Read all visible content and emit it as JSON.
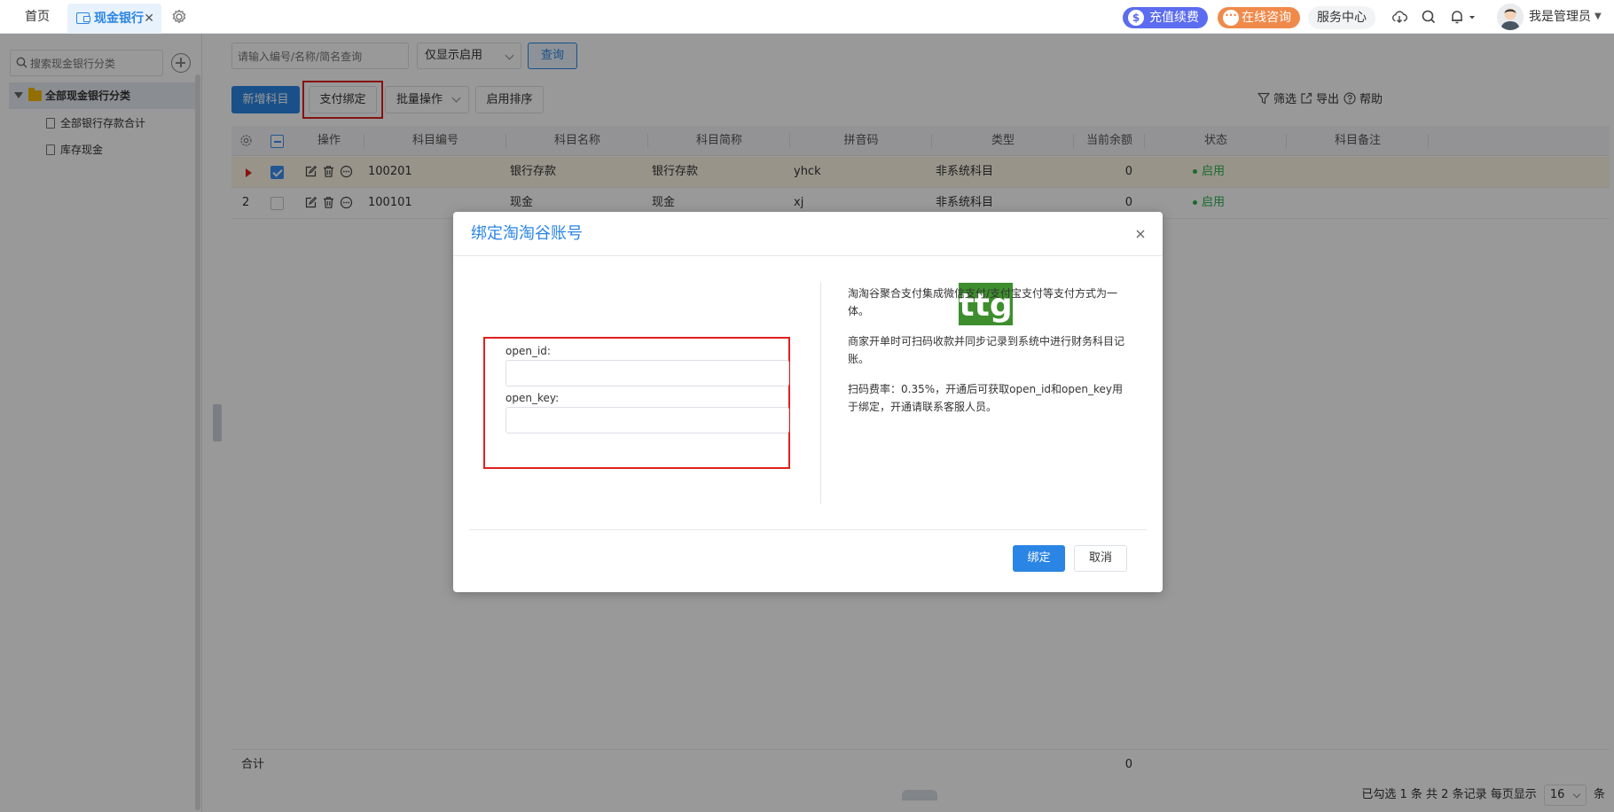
{
  "topbar": {
    "home_tab": "首页",
    "active_tab": "现金银行",
    "close_glyph": "✕",
    "recharge": "充值续费",
    "consult": "在线咨询",
    "service_center": "服务中心",
    "user_name": "我是管理员",
    "icons": [
      "cloud-download-icon",
      "search-icon",
      "bell-icon",
      "avatar"
    ]
  },
  "sidebar": {
    "search_placeholder": "搜索现金银行分类",
    "root_label": "全部现金银行分类",
    "items": [
      "全部银行存款合计",
      "库存现金"
    ]
  },
  "query": {
    "placeholder": "请输入编号/名称/简名查询",
    "filter_value": "仅显示启用",
    "search_button": "查询"
  },
  "toolbar": {
    "add_label": "新增科目",
    "pay_bind_label": "支付绑定",
    "batch_label": "批量操作",
    "sort_label": "启用排序",
    "filter_label": "筛选",
    "export_label": "导出",
    "help_label": "帮助"
  },
  "grid": {
    "columns": [
      "操作",
      "科目编号",
      "科目名称",
      "科目简称",
      "拼音码",
      "类型",
      "当前余额",
      "状态",
      "科目备注"
    ],
    "rows": [
      {
        "index": "",
        "code": "100201",
        "name": "银行存款",
        "short": "银行存款",
        "pinyin": "yhck",
        "type": "非系统科目",
        "balance": "0",
        "status": "启用",
        "selected": true
      },
      {
        "index": "2",
        "code": "100101",
        "name": "现金",
        "short": "现金",
        "pinyin": "xj",
        "type": "非系统科目",
        "balance": "0",
        "status": "启用",
        "selected": false
      }
    ],
    "total_label": "合计",
    "total_balance": "0"
  },
  "pager": {
    "summary": "已勾选 1 条  共 2 条记录  每页显示",
    "page_size": "16",
    "unit": "条"
  },
  "modal": {
    "title": "绑定淘淘谷账号",
    "open_id_label": "open_id:",
    "open_key_label": "open_key:",
    "desc1": "淘淘谷聚合支付集成微信支付/支付宝支付等支付方式为一体。",
    "desc2": "商家开单时可扫码收款并同步记录到系统中进行财务科目记账。",
    "desc3": "扫码费率：0.35%，开通后可获取open_id和open_key用于绑定，开通请联系客服人员。",
    "bind_button": "绑定",
    "cancel_button": "取消",
    "logo_text": "ttg"
  },
  "colors": {
    "primary": "#2b85e4",
    "highlight_red": "#e02020",
    "status_green": "#27b148",
    "recharge_bg": "#5b6cf0",
    "consult_bg": "#f08a4b",
    "logo_green": "#3e8e2e"
  }
}
